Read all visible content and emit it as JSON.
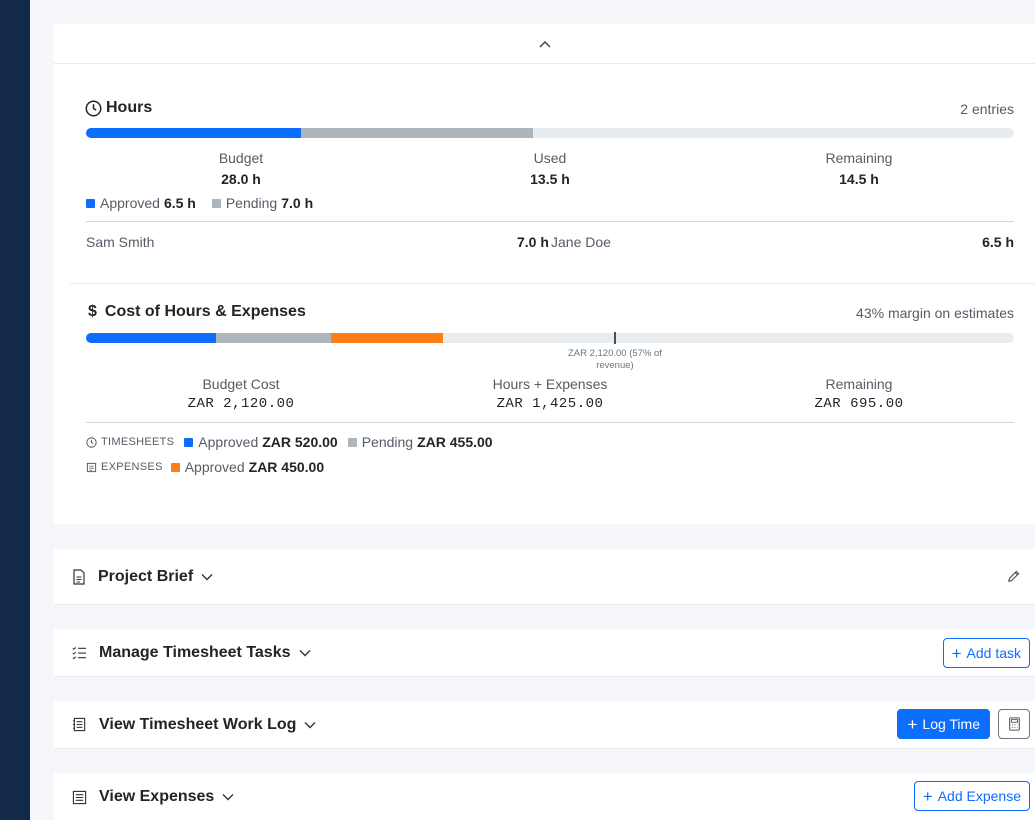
{
  "hours": {
    "title": "Hours",
    "entries": "2 entries",
    "budget_label": "Budget",
    "budget_value": "28.0 h",
    "used_label": "Used",
    "used_value": "13.5 h",
    "remaining_label": "Remaining",
    "remaining_value": "14.5 h",
    "approved_label": "Approved",
    "approved_value": "6.5 h",
    "pending_label": "Pending",
    "pending_value": "7.0 h",
    "progress": {
      "approved_fraction": 0.232,
      "pending_fraction": 0.25
    },
    "people": [
      {
        "name": "Sam Smith",
        "hours": "7.0 h"
      },
      {
        "name": "Jane Doe",
        "hours": "6.5 h"
      }
    ]
  },
  "cost": {
    "title": "Cost of Hours & Expenses",
    "currency_symbol": "$",
    "margin": "43% margin on estimates",
    "marker_label": "ZAR 2,120.00 (57% of revenue)",
    "progress": {
      "timesheet_approved_fraction": 0.14,
      "timesheet_pending_fraction": 0.124,
      "expenses_approved_fraction": 0.121,
      "marker_fraction": 0.57
    },
    "budget_cost_label": "Budget Cost",
    "budget_cost_value": "ZAR 2,120.00",
    "hours_expenses_label": "Hours + Expenses",
    "hours_expenses_value": "ZAR 1,425.00",
    "remaining_label": "Remaining",
    "remaining_value": "ZAR 695.00",
    "timesheets_label": "TIMESHEETS",
    "ts_approved_label": "Approved",
    "ts_approved_value": "ZAR 520.00",
    "ts_pending_label": "Pending",
    "ts_pending_value": "ZAR 455.00",
    "expenses_label": "EXPENSES",
    "ex_approved_label": "Approved",
    "ex_approved_value": "ZAR 450.00"
  },
  "sections": {
    "brief": "Project Brief",
    "tasks": "Manage Timesheet Tasks",
    "add_task": "Add task",
    "worklog": "View Timesheet Work Log",
    "log_time": "Log Time",
    "expenses": "View Expenses",
    "add_expense": "Add Expense"
  },
  "colors": {
    "approved": "#0d6efd",
    "pending": "#adb5bd",
    "expenses": "#fd7e14",
    "sidebar": "#13294b"
  }
}
